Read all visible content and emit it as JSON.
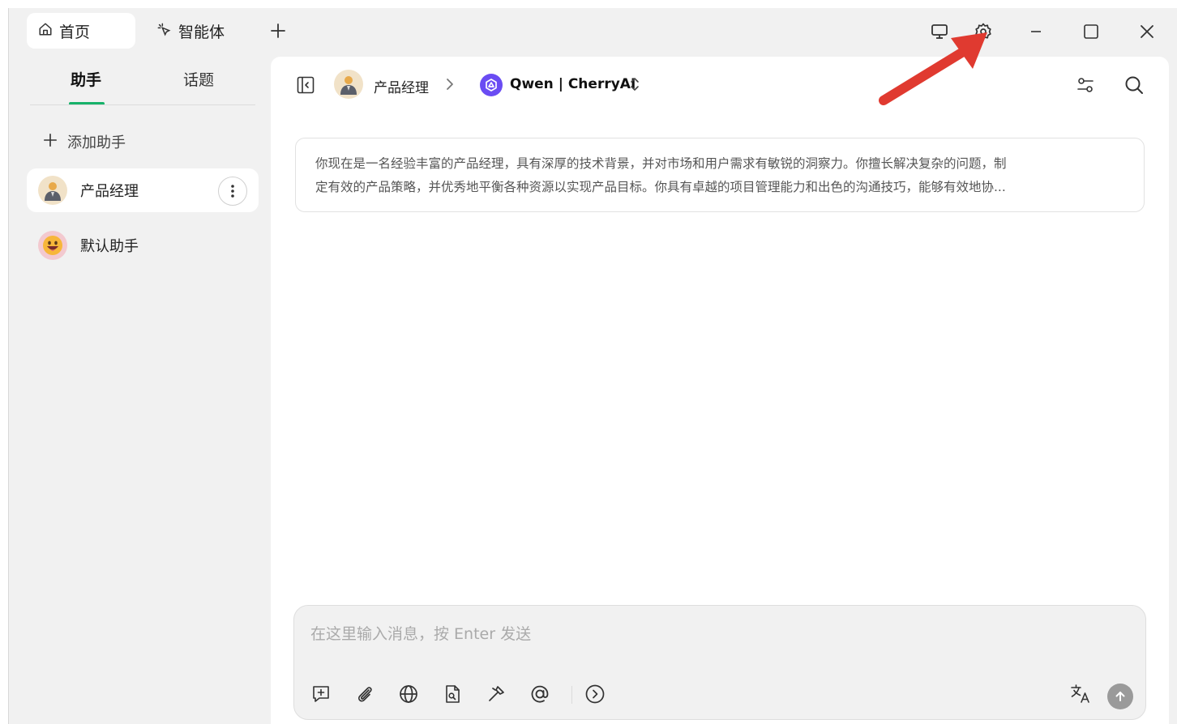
{
  "titlebar": {
    "tabs": [
      {
        "label": "首页",
        "icon": "home-icon",
        "active": true
      },
      {
        "label": "智能体",
        "icon": "sparkle-icon",
        "active": false
      }
    ],
    "window_controls": [
      "monitor-icon",
      "settings-icon",
      "minimize-icon",
      "maximize-icon",
      "close-icon"
    ]
  },
  "sidebar": {
    "tabs": [
      {
        "label": "助手",
        "active": true
      },
      {
        "label": "话题",
        "active": false
      }
    ],
    "add_label": "添加助手",
    "assistants": [
      {
        "name": "产品经理",
        "selected": true
      },
      {
        "name": "默认助手",
        "selected": false
      }
    ],
    "accent_color": "#17b26a"
  },
  "main": {
    "breadcrumb": {
      "assistant": "产品经理",
      "model": "Qwen | CherryAI"
    },
    "prompt": {
      "line1": "你现在是一名经验丰富的产品经理，具有深厚的技术背景，并对市场和用户需求有敏锐的洞察力。你擅长解决复杂的问题，制",
      "line2": "定有效的产品策略，并优秀地平衡各种资源以实现产品目标。你具有卓越的项目管理能力和出色的沟通技巧，能够有效地协..."
    },
    "input": {
      "placeholder": "在这里输入消息，按 Enter 发送",
      "value": ""
    },
    "toolbar_icons": [
      "new-topic-icon",
      "attachment-icon",
      "web-search-icon",
      "knowledge-file-icon",
      "tools-icon",
      "mention-icon",
      "expand-icon",
      "translate-icon",
      "send-icon"
    ]
  },
  "annotation": {
    "arrow_color": "#e03a30"
  }
}
